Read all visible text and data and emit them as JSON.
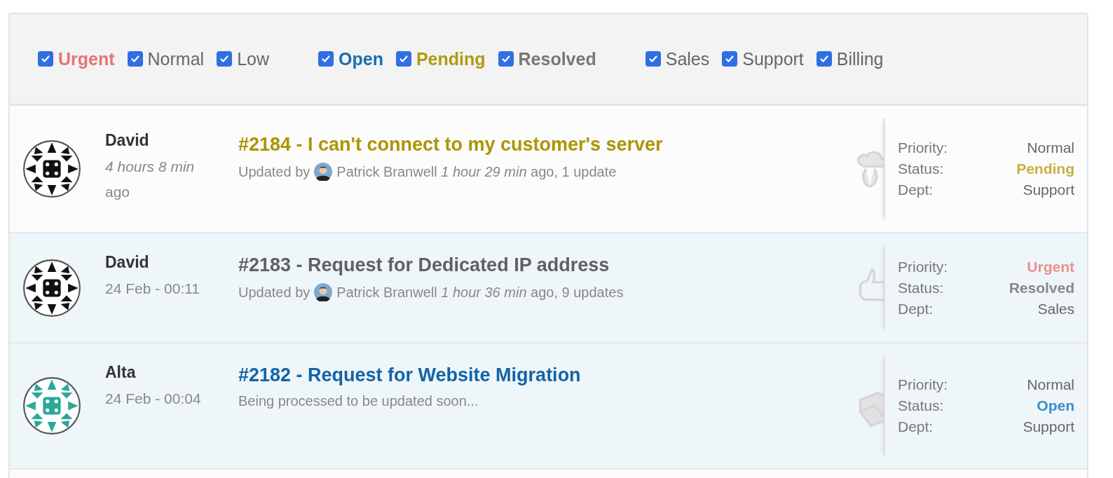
{
  "filters": [
    {
      "items": [
        {
          "label": "Urgent",
          "checked": true,
          "bold": true,
          "color": "#e57373"
        },
        {
          "label": "Normal",
          "checked": true,
          "bold": false,
          "color": "#666666"
        },
        {
          "label": "Low",
          "checked": true,
          "bold": false,
          "color": "#666666"
        }
      ]
    },
    {
      "items": [
        {
          "label": "Open",
          "checked": true,
          "bold": true,
          "color": "#1a6fb0"
        },
        {
          "label": "Pending",
          "checked": true,
          "bold": true,
          "color": "#b09a10"
        },
        {
          "label": "Resolved",
          "checked": true,
          "bold": true,
          "color": "#777777"
        }
      ]
    },
    {
      "items": [
        {
          "label": "Sales",
          "checked": true,
          "bold": false,
          "color": "#666666"
        },
        {
          "label": "Support",
          "checked": true,
          "bold": false,
          "color": "#666666"
        },
        {
          "label": "Billing",
          "checked": true,
          "bold": false,
          "color": "#666666"
        }
      ]
    }
  ],
  "tickets": [
    {
      "highlighted": false,
      "avatar": {
        "color": "#111111"
      },
      "author": "David",
      "time": "*4 hours 8 min* ago",
      "title": "#2184 - I can't connect to my customer's server",
      "kind": "pending",
      "update": {
        "kind": "updated",
        "prefix": "Updated by",
        "text": "Patrick Branwell *1 hour 29 min* ago, 1 update"
      },
      "details": [
        {
          "label": "Priority:",
          "value": "Normal",
          "kind": "normal"
        },
        {
          "label": "Status:",
          "value": "Pending",
          "kind": "pending"
        },
        {
          "label": "Dept:",
          "value": "Support",
          "kind": "plain"
        }
      ]
    },
    {
      "highlighted": true,
      "avatar": {
        "color": "#111111"
      },
      "author": "David",
      "time": "24 Feb - 00:11",
      "title": "#2183 - Request for Dedicated IP address",
      "kind": "resolved",
      "update": {
        "kind": "updated",
        "prefix": "Updated by",
        "text": "Patrick Branwell *1 hour 36 min* ago, 9 updates"
      },
      "details": [
        {
          "label": "Priority:",
          "value": "Urgent",
          "kind": "urgent"
        },
        {
          "label": "Status:",
          "value": "Resolved",
          "kind": "resolved"
        },
        {
          "label": "Dept:",
          "value": "Sales",
          "kind": "plain"
        }
      ]
    },
    {
      "highlighted": true,
      "avatar": {
        "color": "#2aa89a"
      },
      "author": "Alta",
      "time": "24 Feb - 00:04",
      "title": "#2182 - Request for Website Migration",
      "kind": "open",
      "update": {
        "kind": "note",
        "text": "Being processed to be updated soon..."
      },
      "details": [
        {
          "label": "Priority:",
          "value": "Normal",
          "kind": "normal"
        },
        {
          "label": "Status:",
          "value": "Open",
          "kind": "open"
        },
        {
          "label": "Dept:",
          "value": "Support",
          "kind": "plain"
        }
      ]
    }
  ]
}
